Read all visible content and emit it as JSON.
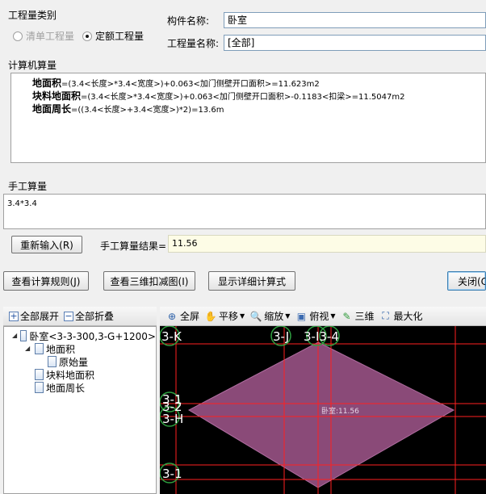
{
  "quantity_type": {
    "title": "工程量类别",
    "options": [
      {
        "label": "清单工程量",
        "checked": false,
        "disabled": true
      },
      {
        "label": "定额工程量",
        "checked": true,
        "disabled": false
      }
    ]
  },
  "component": {
    "name_label": "构件名称:",
    "name_value": "卧室",
    "qty_label": "工程量名称:",
    "qty_value": "[全部]"
  },
  "computer_calc": {
    "title": "计算机算量",
    "lines": [
      {
        "name": "地面积",
        "formula": "=(3.4<长度>*3.4<宽度>)+0.063<加门侧壁开口面积>=11.623m2"
      },
      {
        "name": "块料地面积",
        "formula": "=(3.4<长度>*3.4<宽度>)+0.063<加门侧壁开口面积>-0.1183<扣梁>=11.5047m2"
      },
      {
        "name": "地面周长",
        "formula": "=((3.4<长度>+3.4<宽度>)*2)=13.6m"
      }
    ]
  },
  "manual_calc": {
    "title": "手工算量",
    "expression": "3.4*3.4",
    "reenter_button": "重新输入(R)",
    "result_label": "手工算量结果=",
    "result_value": "11.56"
  },
  "actions": {
    "rules_button": "查看计算规则(J)",
    "view3d_button": "查看三维扣减图(I)",
    "detail_button": "显示详细计算式",
    "close_button": "关闭(C"
  },
  "tree_toolbar": {
    "expand_all": "全部展开",
    "collapse_all": "全部折叠"
  },
  "tree": {
    "root": "卧室<3-3-300,3-G+1200>",
    "children": [
      {
        "label": "地面积",
        "children": [
          {
            "label": "原始量"
          }
        ]
      },
      {
        "label": "块料地面积"
      },
      {
        "label": "地面周长"
      }
    ]
  },
  "view_toolbar": {
    "fullscreen": "全屏",
    "pan": "平移",
    "zoom": "缩放",
    "top_view": "俯视",
    "three_d": "三维",
    "maximize": "最大化"
  },
  "canvas": {
    "axis_labels": [
      "3-K",
      "3-J",
      "3-I3-4",
      "3-1",
      "3-2",
      "3-H",
      "3-1"
    ],
    "room_label": "卧室:11.56",
    "room_fill": "#8a4a78",
    "grid_color": "#ff2020"
  }
}
